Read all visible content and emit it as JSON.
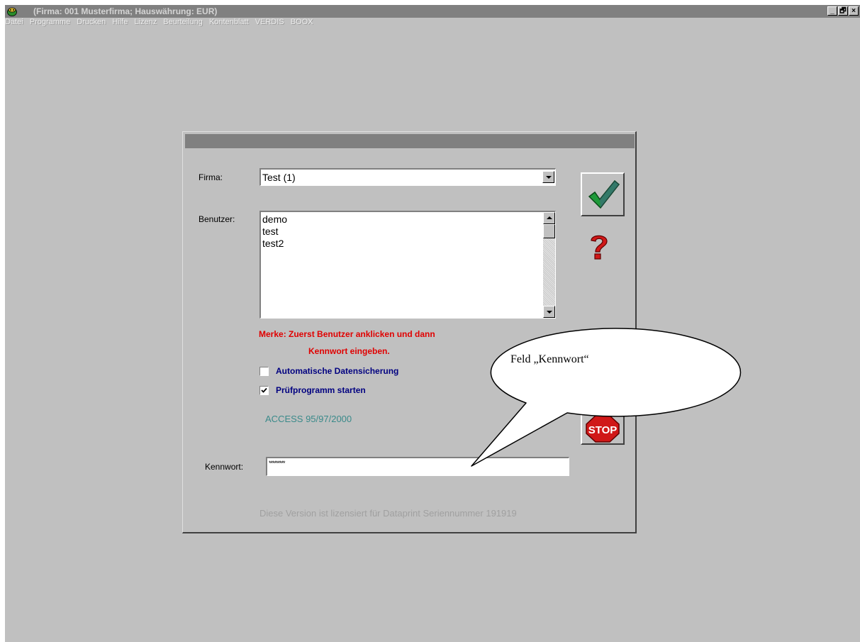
{
  "window": {
    "title": "(Firma: 001 Musterfirma;  Hauswährung: EUR)",
    "buttons": {
      "minimize": "_",
      "restore": "🗗",
      "close": "×"
    }
  },
  "menu": [
    "Datei",
    "Programme",
    "Drucken",
    "Hilfe",
    "Lizenz",
    "Beurteilung",
    "Kontenblatt",
    "VERDIS",
    "BOOX"
  ],
  "login": {
    "firma_label": "Firma:",
    "firma_value": "Test (1)",
    "benutzer_label": "Benutzer:",
    "users": [
      "demo",
      "test",
      "test2"
    ],
    "merke_line1": "Merke:  Zuerst Benutzer anklicken und dann",
    "merke_line2": "Kennwort eingeben.",
    "auto_backup_label": "Automatische Datensicherung",
    "auto_backup_checked": false,
    "pruef_label": "Prüfprogramm starten",
    "pruef_checked": true,
    "access_version": "ACCESS 95/97/2000",
    "kennwort_label": "Kennwort:",
    "kennwort_value": "*********",
    "license_text": "Diese Version ist lizensiert für Dataprint   Seriennummer 191919"
  },
  "callout": {
    "text": "Feld „Kennwort“"
  },
  "colors": {
    "warning_red": "#e00000",
    "label_navy": "#000080",
    "access_teal": "#3a8a8a"
  }
}
